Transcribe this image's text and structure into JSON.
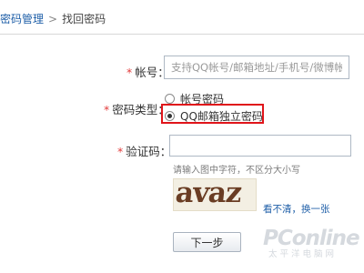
{
  "breadcrumb": {
    "parent": "密码管理",
    "separator": ">",
    "current": "找回密码"
  },
  "form": {
    "account": {
      "required_mark": "*",
      "label": "帐号：",
      "placeholder": "支持QQ帐号/邮箱地址/手机号/微博帐号",
      "value": ""
    },
    "password_type": {
      "required_mark": "*",
      "label": "密码类型：",
      "options": [
        {
          "label": "帐号密码",
          "selected": false
        },
        {
          "label": "QQ邮箱独立密码",
          "selected": true
        }
      ]
    },
    "verify_code": {
      "required_mark": "*",
      "label": "验证码：",
      "value": "",
      "hint": "请输入图中字符，不区分大小写",
      "captcha_text": "avaz",
      "refresh_link": "看不清，换一张"
    },
    "next_button": "下一步"
  },
  "watermark": {
    "main": "PConline",
    "sub": "太平洋电脑网"
  },
  "colors": {
    "link": "#1f5fa8",
    "required": "#e23b3b",
    "highlight_border": "#e0141a"
  }
}
